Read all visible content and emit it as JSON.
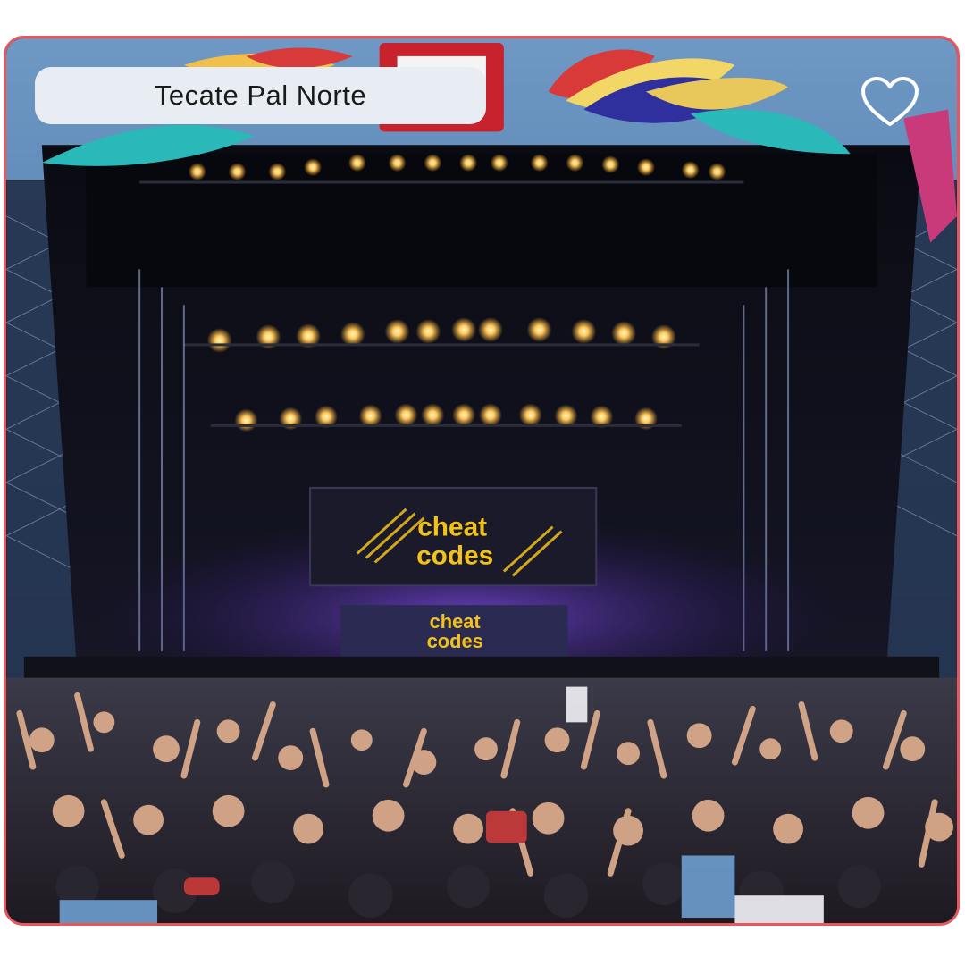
{
  "card": {
    "title": "Tecate Pal Norte",
    "favorite_icon": "heart-outline-icon",
    "photo": {
      "screen_text_line1": "cheat",
      "screen_text_line2": "codes"
    }
  },
  "colors": {
    "border": "#e8575c",
    "pill_bg": "#e8edf3",
    "heart_stroke": "#ffffff",
    "screen_text": "#f2c21b"
  }
}
